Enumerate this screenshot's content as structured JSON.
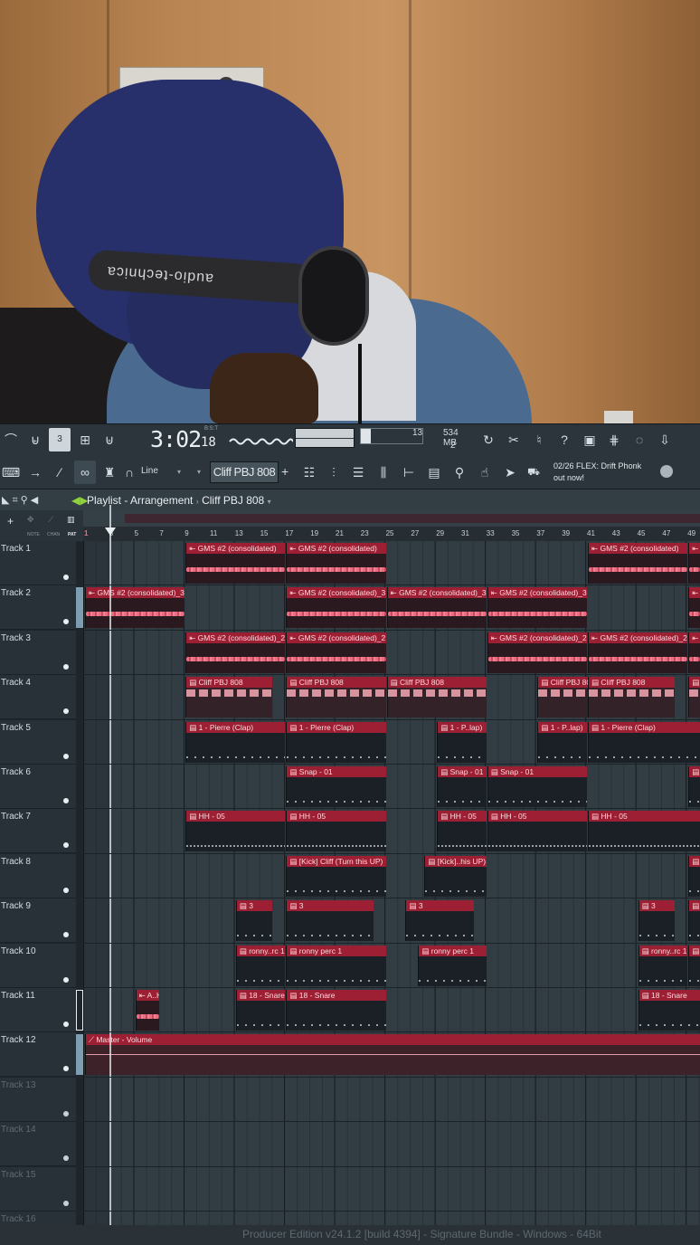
{
  "webcam": {
    "headband_brand": "audio-technica"
  },
  "toolbar": {
    "time": "3:02",
    "time_ticks": "18",
    "time_mode": "B:S:T",
    "cpu_cores": "13",
    "memory": "534 MB",
    "polyphony": "2",
    "snap_label": "Line",
    "pattern_name": "Cliff PBJ 808",
    "news_date": "02/26",
    "news_line1": "FLEX: Drift Phonk",
    "news_line2": "out now!",
    "icons_row1": [
      "metronome-icon",
      "wait-record-icon",
      "countdown-icon",
      "step-edit-icon",
      "blend-notes-icon"
    ],
    "icons_row2": [
      "keyboard-icon",
      "next-icon",
      "paint-icon",
      "link-icon",
      "stamp-icon",
      "magnet-icon"
    ]
  },
  "playlist": {
    "title": "Playlist - Arrangement",
    "separator": "›",
    "pattern": "Cliff PBJ 808",
    "tool_labels": [
      "NOTE",
      "CHAN",
      "PAT"
    ],
    "ruler_numbers": [
      "1",
      "3",
      "5",
      "7",
      "9",
      "11",
      "13",
      "15",
      "17",
      "19",
      "21",
      "23",
      "25",
      "27",
      "29",
      "31",
      "33",
      "35",
      "37",
      "39",
      "41",
      "43",
      "45",
      "47",
      "49"
    ],
    "tracks": [
      {
        "name": "Track 1",
        "clips": [
          {
            "label": "GMS #2 (consolidated)",
            "type": "audio",
            "bar": 9,
            "len": 8
          },
          {
            "label": "GMS #2 (consolidated)",
            "type": "audio",
            "bar": 17,
            "len": 8
          },
          {
            "label": "GMS #2 (consolidated)",
            "type": "audio",
            "bar": 41,
            "len": 8
          },
          {
            "label": "G",
            "type": "audio",
            "bar": 49,
            "len": 1
          }
        ]
      },
      {
        "name": "Track 2",
        "clips": [
          {
            "label": "GMS #2 (consolidated)_3",
            "type": "audio",
            "bar": 1,
            "len": 8
          },
          {
            "label": "GMS #2 (consolidated)_3",
            "type": "audio",
            "bar": 17,
            "len": 8
          },
          {
            "label": "GMS #2 (consolidated)_3",
            "type": "audio",
            "bar": 25,
            "len": 8
          },
          {
            "label": "GMS #2 (consolidated)_3",
            "type": "audio",
            "bar": 33,
            "len": 8
          },
          {
            "label": "G",
            "type": "audio",
            "bar": 49,
            "len": 1
          }
        ]
      },
      {
        "name": "Track 3",
        "clips": [
          {
            "label": "GMS #2 (consolidated)_2",
            "type": "audio",
            "bar": 9,
            "len": 8
          },
          {
            "label": "GMS #2 (consolidated)_2",
            "type": "audio",
            "bar": 17,
            "len": 8
          },
          {
            "label": "GMS #2 (consolidated)_2",
            "type": "audio",
            "bar": 33,
            "len": 8
          },
          {
            "label": "GMS #2 (consolidated)_2",
            "type": "audio",
            "bar": 41,
            "len": 8
          },
          {
            "label": "G",
            "type": "audio",
            "bar": 49,
            "len": 1
          }
        ]
      },
      {
        "name": "Track 4",
        "clips": [
          {
            "label": "Cliff PBJ 808",
            "type": "cliff",
            "bar": 9,
            "len": 7
          },
          {
            "label": "Cliff PBJ 808",
            "type": "cliff",
            "bar": 17,
            "len": 8
          },
          {
            "label": "Cliff PBJ 808",
            "type": "cliff",
            "bar": 25,
            "len": 8
          },
          {
            "label": "Cliff PBJ 808",
            "type": "cliff",
            "bar": 37,
            "len": 5
          },
          {
            "label": "Cliff PBJ 808",
            "type": "cliff",
            "bar": 41,
            "len": 7
          },
          {
            "label": "C",
            "type": "cliff",
            "bar": 49,
            "len": 1
          }
        ]
      },
      {
        "name": "Track 5",
        "clips": [
          {
            "label": "1 - Pierre (Clap)",
            "type": "pattern",
            "bar": 9,
            "len": 8
          },
          {
            "label": "1 - Pierre (Clap)",
            "type": "pattern",
            "bar": 17,
            "len": 8
          },
          {
            "label": "1 - P..lap)",
            "type": "pattern",
            "bar": 29,
            "len": 4
          },
          {
            "label": "1 - P..lap)",
            "type": "pattern",
            "bar": 37,
            "len": 4
          },
          {
            "label": "1 - Pierre (Clap)",
            "type": "pattern",
            "bar": 41,
            "len": 9
          }
        ]
      },
      {
        "name": "Track 6",
        "clips": [
          {
            "label": "Snap - 01",
            "type": "pattern",
            "bar": 17,
            "len": 8
          },
          {
            "label": "Snap - 01",
            "type": "pattern",
            "bar": 29,
            "len": 4
          },
          {
            "label": "Snap - 01",
            "type": "pattern",
            "bar": 33,
            "len": 8
          },
          {
            "label": "S",
            "type": "pattern",
            "bar": 49,
            "len": 1
          }
        ]
      },
      {
        "name": "Track 7",
        "clips": [
          {
            "label": "HH - 05",
            "type": "dense",
            "bar": 9,
            "len": 8
          },
          {
            "label": "HH - 05",
            "type": "dense",
            "bar": 17,
            "len": 8
          },
          {
            "label": "HH - 05",
            "type": "dense",
            "bar": 29,
            "len": 4
          },
          {
            "label": "HH - 05",
            "type": "dense",
            "bar": 33,
            "len": 8
          },
          {
            "label": "HH - 05",
            "type": "dense",
            "bar": 41,
            "len": 9
          }
        ]
      },
      {
        "name": "Track 8",
        "clips": [
          {
            "label": "[Kick] Cliff (Turn this UP)",
            "type": "pattern",
            "bar": 17,
            "len": 8
          },
          {
            "label": "[Kick]..his UP)",
            "type": "pattern",
            "bar": 28,
            "len": 5
          },
          {
            "label": "[",
            "type": "pattern",
            "bar": 49,
            "len": 1
          }
        ]
      },
      {
        "name": "Track 9",
        "clips": [
          {
            "label": "3",
            "type": "pattern",
            "bar": 13,
            "len": 3
          },
          {
            "label": "3",
            "type": "pattern",
            "bar": 17,
            "len": 7
          },
          {
            "label": "3",
            "type": "pattern",
            "bar": 26.5,
            "len": 5.5
          },
          {
            "label": "3",
            "type": "pattern",
            "bar": 45,
            "len": 3
          },
          {
            "label": "3",
            "type": "pattern",
            "bar": 49,
            "len": 1
          }
        ]
      },
      {
        "name": "Track 10",
        "clips": [
          {
            "label": "ronny..rc 1",
            "type": "pattern",
            "bar": 13,
            "len": 4
          },
          {
            "label": "ronny perc 1",
            "type": "pattern",
            "bar": 17,
            "len": 8
          },
          {
            "label": "ronny perc 1",
            "type": "pattern",
            "bar": 27.5,
            "len": 5.5
          },
          {
            "label": "ronny..rc 1",
            "type": "pattern",
            "bar": 45,
            "len": 4
          },
          {
            "label": "r",
            "type": "pattern",
            "bar": 49,
            "len": 1
          }
        ]
      },
      {
        "name": "Track 11",
        "clips": [
          {
            "label": "A..H",
            "type": "audio",
            "bar": 5,
            "len": 2
          },
          {
            "label": "18 - Snare",
            "type": "pattern",
            "bar": 13,
            "len": 4
          },
          {
            "label": "18 - Snare",
            "type": "pattern",
            "bar": 17,
            "len": 8
          },
          {
            "label": "18 - Snare",
            "type": "pattern",
            "bar": 45,
            "len": 5
          }
        ]
      },
      {
        "name": "Track 12",
        "clips": [
          {
            "label": "Master - Volume",
            "type": "automation",
            "bar": 1,
            "len": 49
          }
        ]
      },
      {
        "name": "Track 13",
        "clips": []
      },
      {
        "name": "Track 14",
        "clips": []
      },
      {
        "name": "Track 15",
        "clips": []
      },
      {
        "name": "Track 16",
        "clips": []
      }
    ]
  },
  "status_bar": {
    "text": "Producer Edition v24.1.2 [build 4394] - Signature Bundle - Windows - 64Bit"
  },
  "colors": {
    "clip_header": "#9c1f33",
    "waveform": "#e96e82",
    "background": "#313c43",
    "accent_green": "#8fd23a"
  }
}
